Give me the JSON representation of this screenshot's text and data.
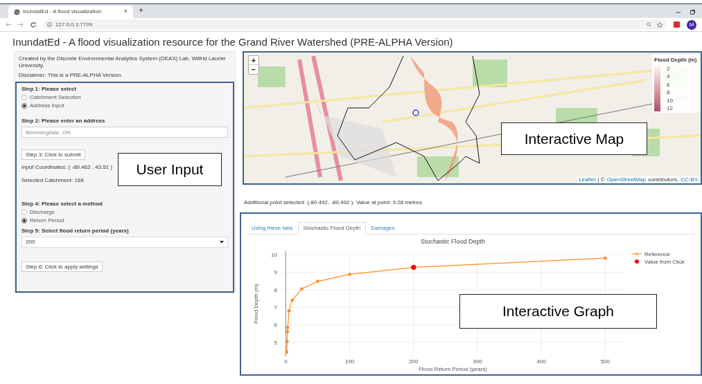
{
  "browser": {
    "tab_title": "InundatEd - A flood visualization",
    "tab_close": "×",
    "new_tab": "+",
    "address": "127.0.0.1:7709",
    "profile_initial": "M"
  },
  "page_title": "InundatEd - A flood visualization resource for the Grand River Watershed (PRE-ALPHA Version)",
  "sidebar": {
    "credit": "Created by the Discrete Environmental Analytics System (DEAS) Lab, Wilfrid Laurier University.",
    "disclaimer": "Disclaimer: This is a PRE-ALPHA Version.",
    "step1": {
      "label": "Step 1: Please select",
      "options": [
        {
          "label": "Catchment Selection",
          "selected": false
        },
        {
          "label": "Address Input",
          "selected": true
        }
      ]
    },
    "step2": {
      "label": "Step 2: Please enter an address",
      "placeholder": "Bloomingdale, ON"
    },
    "submit_button": "Step 3: Click to submit",
    "coordinates": "Input Coordinates: ( -80.462 , 43.51 )",
    "catchment": "Selected Catchment: 166",
    "step4": {
      "label": "Step 4: Please select a method",
      "options": [
        {
          "label": "Discharge",
          "selected": false
        },
        {
          "label": "Return Period",
          "selected": true
        }
      ]
    },
    "step5": {
      "label": "Step 5: Select flood return period (years)",
      "value": "200"
    },
    "apply_button": "Step 6: Click to apply settings"
  },
  "map": {
    "zoom_in": "+",
    "zoom_out": "−",
    "legend_title": "Flood Depth (m)",
    "legend_ticks": [
      "2",
      "4",
      "6",
      "8",
      "10",
      "12"
    ],
    "attribution": [
      {
        "text": "Leaflet",
        "link": true
      },
      {
        "text": "| ©",
        "link": false
      },
      {
        "text": "OpenStreetMap",
        "link": true
      },
      {
        "text": "contributors,",
        "link": false
      },
      {
        "text": "CC-BY-",
        "link": true
      }
    ]
  },
  "point_info": "Additional point selected: (-80.492, -80.492 ). Value at point: 9.28 metres",
  "graph": {
    "tabs": [
      {
        "label": "Using these tabs",
        "selected": false
      },
      {
        "label": "Stochastic Flood Depth",
        "selected": true
      },
      {
        "label": "Damages",
        "selected": false
      }
    ],
    "chart_data": {
      "type": "line",
      "title": "Stochastic Flood Depth",
      "xlabel": "Flood Return Period (years)",
      "ylabel": "Flood Depth (m)",
      "xlim": [
        -7,
        530
      ],
      "ylim": [
        4.2,
        10.2
      ],
      "xticks": [
        0,
        100,
        200,
        300,
        400,
        500
      ],
      "yticks": [
        5,
        6,
        7,
        8,
        9,
        10
      ],
      "grid": true,
      "legend": "right",
      "x": [
        1.5,
        2,
        2.5,
        3,
        5,
        10,
        25,
        50,
        100,
        200,
        500
      ],
      "series": [
        {
          "name": "Reference",
          "color": "#ff8c1a",
          "values": [
            4.45,
            5.05,
            5.6,
            5.85,
            6.8,
            7.4,
            8.05,
            8.48,
            8.88,
            9.28,
            9.8
          ]
        },
        {
          "name": "Value from Click",
          "color": "#ff0000",
          "marker": "circle",
          "values": [
            null,
            null,
            null,
            null,
            null,
            null,
            null,
            null,
            null,
            9.28,
            null
          ]
        }
      ]
    }
  },
  "callouts": [
    {
      "text": "User Input"
    },
    {
      "text": "Interactive Map"
    },
    {
      "text": "Interactive Graph"
    }
  ]
}
